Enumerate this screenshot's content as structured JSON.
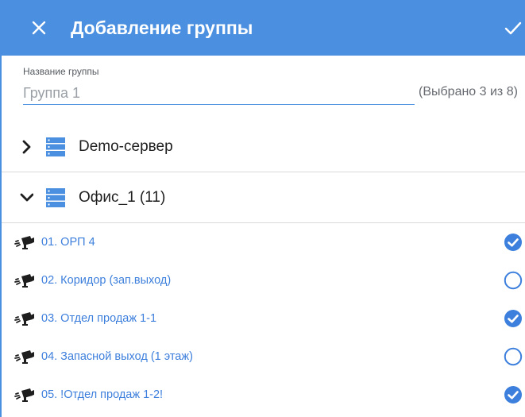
{
  "header": {
    "title": "Добавление группы",
    "close_icon": "close-icon",
    "confirm_icon": "check-icon",
    "color": "#4a8fe0"
  },
  "form": {
    "group_name_label": "Название группы",
    "group_name_placeholder": "Группа 1",
    "group_name_value": "",
    "selected_count": "(Выбрано 3 из 8)"
  },
  "servers": [
    {
      "label": "Demo-сервер",
      "expanded": false
    },
    {
      "label": "Офис_1 (11)",
      "expanded": true
    }
  ],
  "cameras": [
    {
      "label": "01. ОРП 4",
      "checked": true
    },
    {
      "label": "02. Коридор (зап.выход)",
      "checked": false
    },
    {
      "label": "03. Отдел продаж 1-1",
      "checked": true
    },
    {
      "label": "04. Запасной выход (1 этаж)",
      "checked": false
    },
    {
      "label": "05. !Отдел продаж 1-2!",
      "checked": true
    }
  ],
  "colors": {
    "accent": "#4a8fe0",
    "camera_text": "#3d7fdc",
    "divider": "#d9d9d9"
  }
}
